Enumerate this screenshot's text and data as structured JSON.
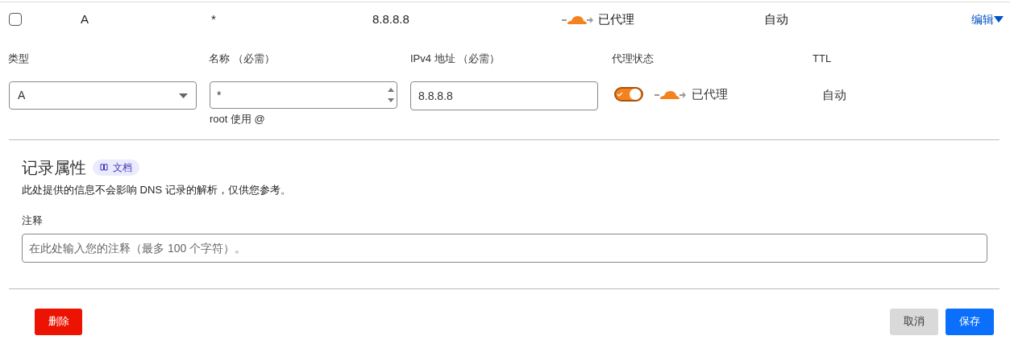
{
  "record_row": {
    "checked": false,
    "type": "A",
    "name": "*",
    "content": "8.8.8.8",
    "proxied": true,
    "proxy_status": "已代理",
    "ttl": "自动",
    "edit_link": "编辑"
  },
  "form": {
    "type": {
      "label": "类型",
      "value": "A"
    },
    "name": {
      "label": "名称 （必需）",
      "value": "*",
      "hint": "root 使用 @"
    },
    "ipv4": {
      "label": "IPv4 地址 （必需）",
      "value": "8.8.8.8"
    },
    "proxy": {
      "label": "代理状态",
      "on": true,
      "status": "已代理"
    },
    "ttl": {
      "label": "TTL",
      "value": "自动"
    }
  },
  "record_attributes": {
    "title": "记录属性",
    "docs_badge": "文档",
    "description": "此处提供的信息不会影响 DNS 记录的解析，仅供您参考。",
    "comment_label": "注释",
    "comment_placeholder": "在此处输入您的注释（最多 100 个字符）。"
  },
  "buttons": {
    "delete": "删除",
    "cancel": "取消",
    "save": "保存"
  }
}
